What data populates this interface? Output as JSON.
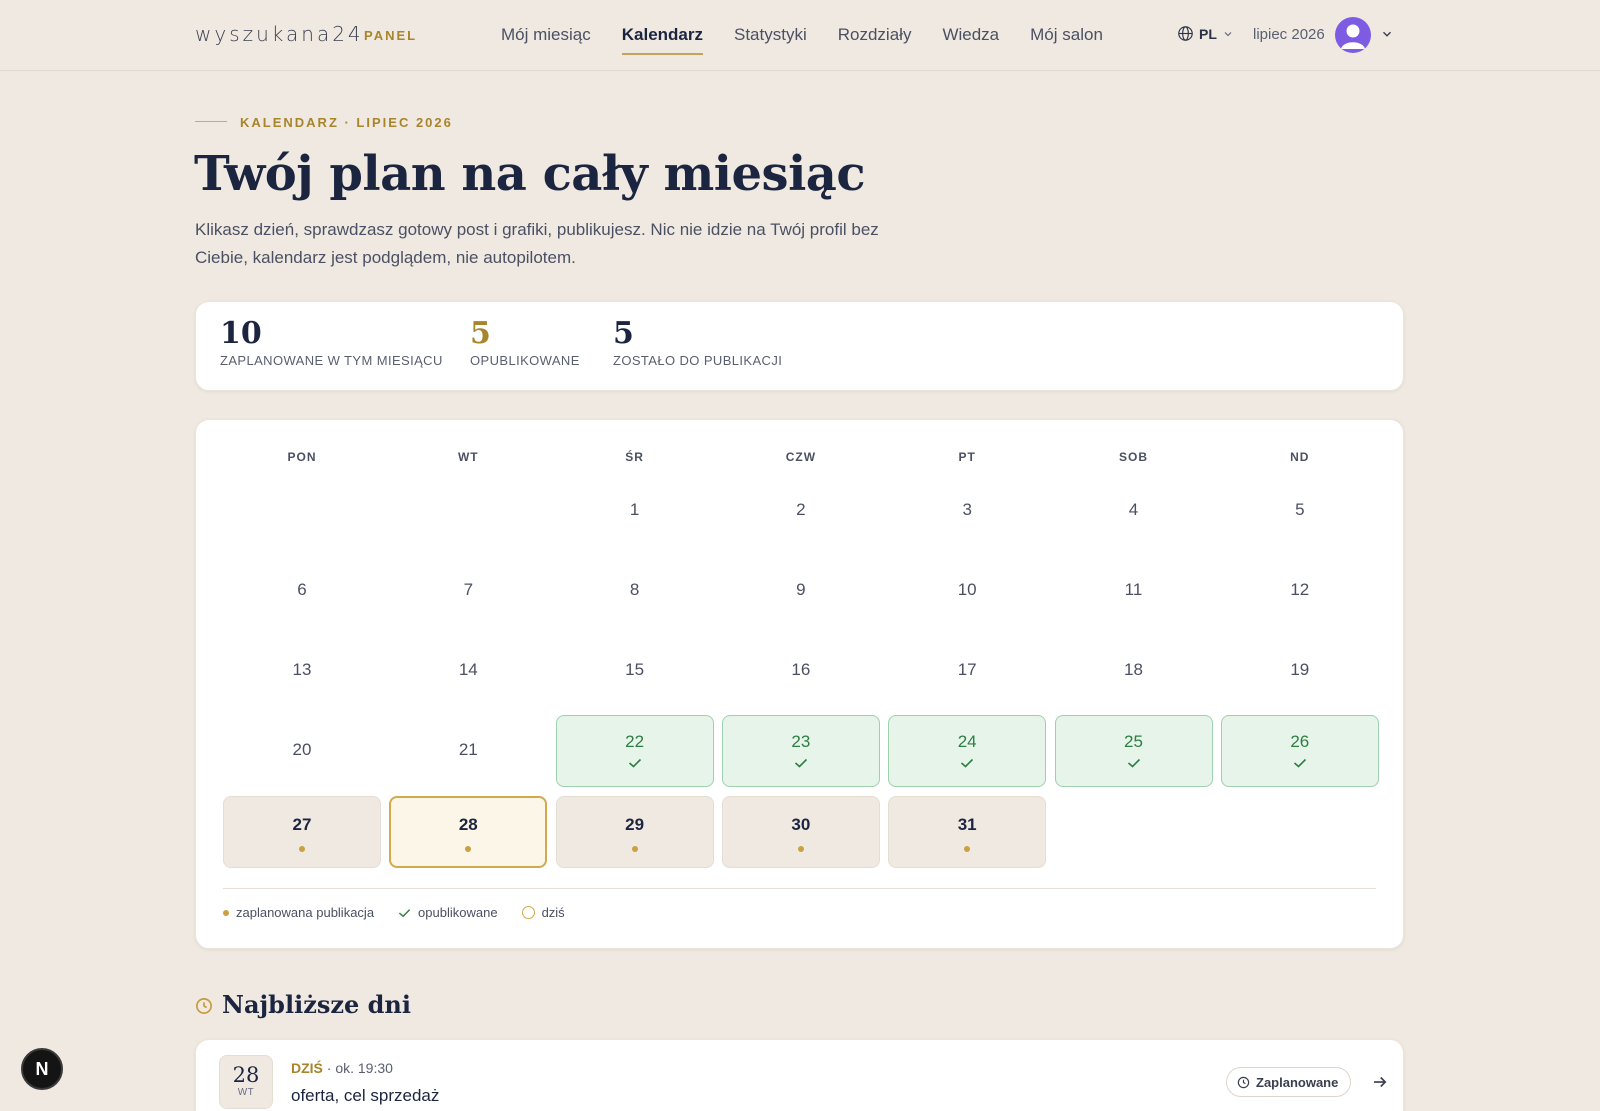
{
  "header": {
    "logo": "wyszukana24",
    "logo_tag": "PANEL",
    "nav": [
      {
        "label": "Mój miesiąc",
        "active": false
      },
      {
        "label": "Kalendarz",
        "active": true
      },
      {
        "label": "Statystyki",
        "active": false
      },
      {
        "label": "Rozdziały",
        "active": false
      },
      {
        "label": "Wiedza",
        "active": false
      },
      {
        "label": "Mój salon",
        "active": false
      }
    ],
    "lang": "PL",
    "month": "lipiec 2026"
  },
  "hero": {
    "eyebrow": "KALENDARZ · LIPIEC 2026",
    "title": "Twój plan na cały miesiąc",
    "description": "Klikasz dzień, sprawdzasz gotowy post i grafiki, publikujesz. Nic nie idzie na Twój profil bez Ciebie, kalendarz jest podglądem, nie autopilotem."
  },
  "stats": [
    {
      "value": "10",
      "label": "ZAPLANOWANE W TYM MIESIĄCU",
      "color": "#1c2540"
    },
    {
      "value": "5",
      "label": "OPUBLIKOWANE",
      "color": "#a8842a"
    },
    {
      "value": "5",
      "label": "ZOSTAŁO DO PUBLIKACJI",
      "color": "#1c2540"
    }
  ],
  "calendar": {
    "weekdays": [
      "PON",
      "WT",
      "ŚR",
      "CZW",
      "PT",
      "SOB",
      "ND"
    ],
    "first_weekday_index": 2,
    "days_in_month": 31,
    "published": [
      22,
      23,
      24,
      25,
      26
    ],
    "planned": [
      27,
      28,
      29,
      30,
      31
    ],
    "today": 28,
    "legend": {
      "planned": "zaplanowana publikacja",
      "published": "opublikowane",
      "today": "dziś"
    }
  },
  "upcoming": {
    "title": "Najbliższe dni",
    "items": [
      {
        "day": "28",
        "dow": "WT",
        "when": "DZIŚ",
        "time": "· ok. 19:30",
        "title": "oferta, cel sprzedaż",
        "status": "Zaplanowane"
      }
    ]
  },
  "fab_label": "N",
  "colors": {
    "accent": "#c5a35a",
    "gold_text": "#a8842a",
    "navy": "#1c2540",
    "published_bg": "#e6f4ea",
    "published_text": "#2e7d42",
    "background": "#efe9e1"
  }
}
